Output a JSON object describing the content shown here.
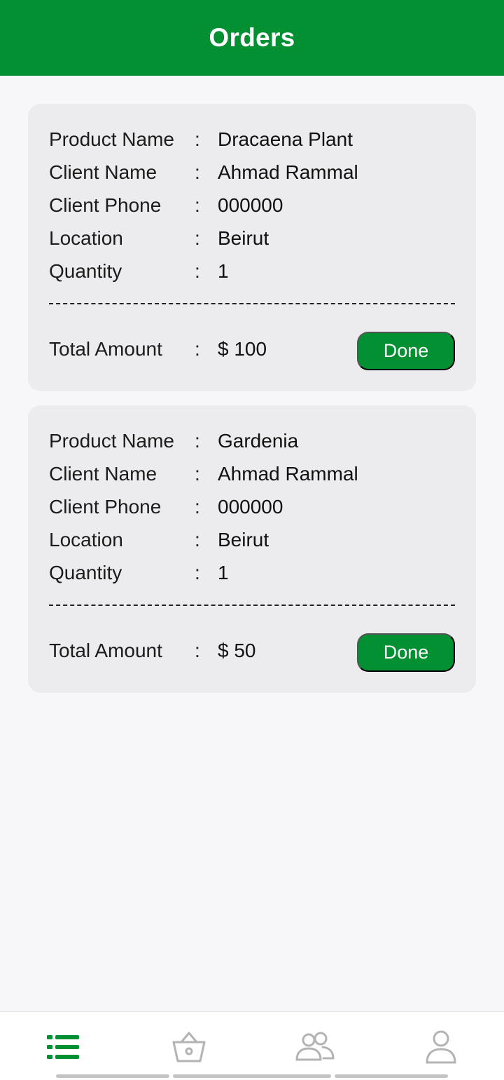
{
  "header": {
    "title": "Orders"
  },
  "labels": {
    "product_name": "Product Name",
    "client_name": "Client Name",
    "client_phone": "Client Phone",
    "location": "Location",
    "quantity": "Quantity",
    "total_amount": "Total Amount",
    "separator": ":"
  },
  "orders": [
    {
      "product_name": "Dracaena Plant",
      "client_name": "Ahmad Rammal",
      "client_phone": "000000",
      "location": "Beirut",
      "quantity": "1",
      "total_amount": "$ 100",
      "action_label": "Done"
    },
    {
      "product_name": "Gardenia",
      "client_name": "Ahmad Rammal",
      "client_phone": "000000",
      "location": "Beirut",
      "quantity": "1",
      "total_amount": "$ 50",
      "action_label": "Done"
    }
  ],
  "bottom_nav": {
    "items": [
      {
        "icon": "list-icon",
        "active": true
      },
      {
        "icon": "basket-icon",
        "active": false
      },
      {
        "icon": "users-icon",
        "active": false
      },
      {
        "icon": "profile-icon",
        "active": false
      }
    ]
  },
  "colors": {
    "primary": "#039033",
    "card_background": "#ececee",
    "page_background": "#f7f7f9",
    "inactive_icon": "#b3b3b3"
  }
}
